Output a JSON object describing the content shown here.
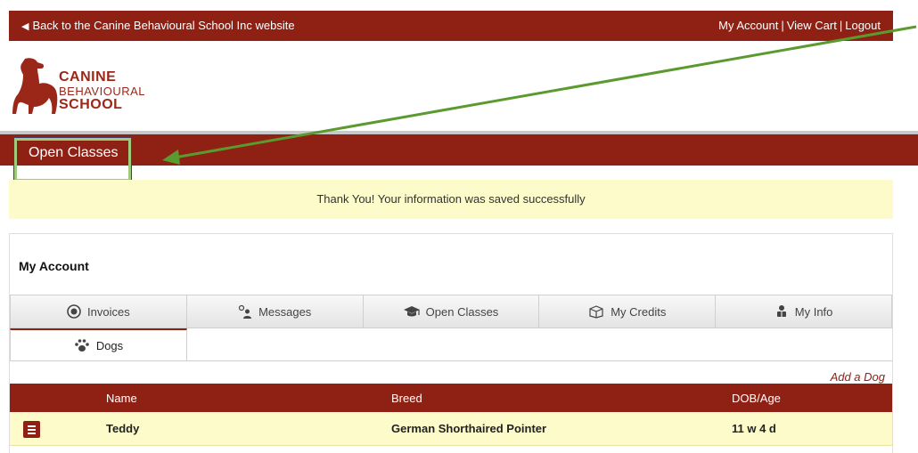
{
  "topbar": {
    "back_link": "Back to the Canine Behavioural School Inc website",
    "my_account": "My Account",
    "view_cart": "View Cart",
    "logout": "Logout",
    "separator": "|"
  },
  "logo": {
    "line1": "CANINE",
    "line2": "BEHAVIOURAL",
    "line3": "SCHOOL"
  },
  "nav": {
    "open_classes": "Open Classes"
  },
  "alert": {
    "message": "Thank You! Your information was saved successfully"
  },
  "account": {
    "title": "My Account",
    "tabs": [
      {
        "label": "Invoices",
        "icon": "invoice-icon"
      },
      {
        "label": "Messages",
        "icon": "messages-icon"
      },
      {
        "label": "Open Classes",
        "icon": "graduation-cap-icon"
      },
      {
        "label": "My Credits",
        "icon": "credits-box-icon"
      },
      {
        "label": "My Info",
        "icon": "user-icon"
      }
    ],
    "active_tab": {
      "label": "Dogs",
      "icon": "paw-icon"
    },
    "add_dog": "Add a Dog",
    "columns": [
      "Name",
      "Breed",
      "DOB/Age"
    ],
    "rows": [
      {
        "name": "Teddy",
        "breed": "German Shorthaired Pointer",
        "age": "11 w 4 d"
      }
    ]
  },
  "colors": {
    "brand": "#8f2114",
    "alert_bg": "#fcfbc9",
    "highlight_border": "#9fcc7a",
    "annotation_arrow": "#5a9a2e"
  }
}
